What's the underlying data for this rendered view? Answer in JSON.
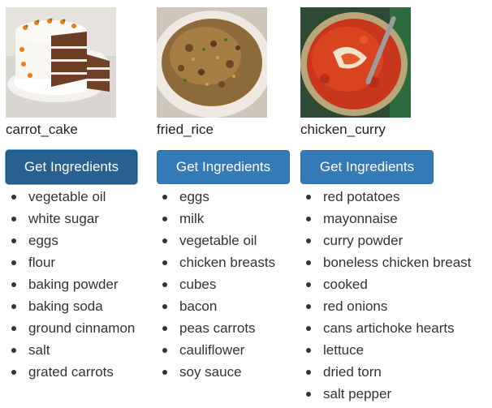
{
  "recipes": [
    {
      "name": "carrot_cake",
      "button_label": "Get Ingredients",
      "image_icon": "carrot-cake-photo",
      "ingredients": [
        "vegetable oil",
        "white sugar",
        "eggs",
        "flour",
        "baking powder",
        "baking soda",
        "ground cinnamon",
        "salt",
        "grated carrots"
      ]
    },
    {
      "name": "fried_rice",
      "button_label": "Get Ingredients",
      "image_icon": "fried-rice-photo",
      "ingredients": [
        "eggs",
        "milk",
        "vegetable oil",
        "chicken breasts",
        "cubes",
        "bacon",
        "peas carrots",
        "cauliflower",
        "soy sauce"
      ]
    },
    {
      "name": "chicken_curry",
      "button_label": "Get Ingredients",
      "image_icon": "chicken-curry-photo",
      "ingredients": [
        "red potatoes",
        "mayonnaise",
        "curry powder",
        "boneless chicken breast",
        "cooked",
        "red onions",
        "cans artichoke hearts",
        "lettuce",
        "dried torn",
        "salt pepper"
      ]
    }
  ],
  "colors": {
    "button_bg": "#337ab7",
    "button_active_bg": "#286090",
    "button_text": "#ffffff",
    "text": "#333333"
  }
}
